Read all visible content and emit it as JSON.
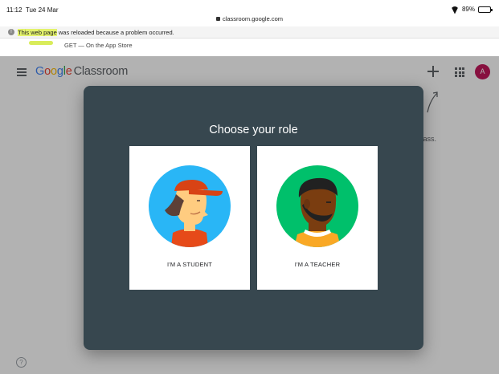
{
  "status_bar": {
    "time": "11:12",
    "date": "Tue 24 Mar",
    "url": "classroom.google.com",
    "battery": "89%",
    "battery_level": 0.89
  },
  "notice": {
    "text_highlight": "This web page",
    "text_rest": " was reloaded because a problem occurred."
  },
  "app_banner": {
    "get_text": "GET — On the App Store"
  },
  "appbar": {
    "logo_letters": [
      "G",
      "o",
      "o",
      "g",
      "l",
      "e"
    ],
    "product": "Classroom",
    "avatar_initial": "A"
  },
  "page": {
    "hint_fragment": "t class."
  },
  "dialog": {
    "title": "Choose your role",
    "student_label": "I'M A STUDENT",
    "teacher_label": "I'M A TEACHER"
  },
  "help": {
    "symbol": "?"
  },
  "colors": {
    "dialog_bg": "#37474f",
    "student_circle": "#29b6f6",
    "teacher_circle": "#00c06b",
    "avatar": "#c2185b"
  },
  "icons": [
    "menu-icon",
    "plus-icon",
    "apps-icon",
    "help-icon",
    "wifi-icon",
    "battery-icon",
    "lock-icon",
    "reload-info-icon"
  ]
}
